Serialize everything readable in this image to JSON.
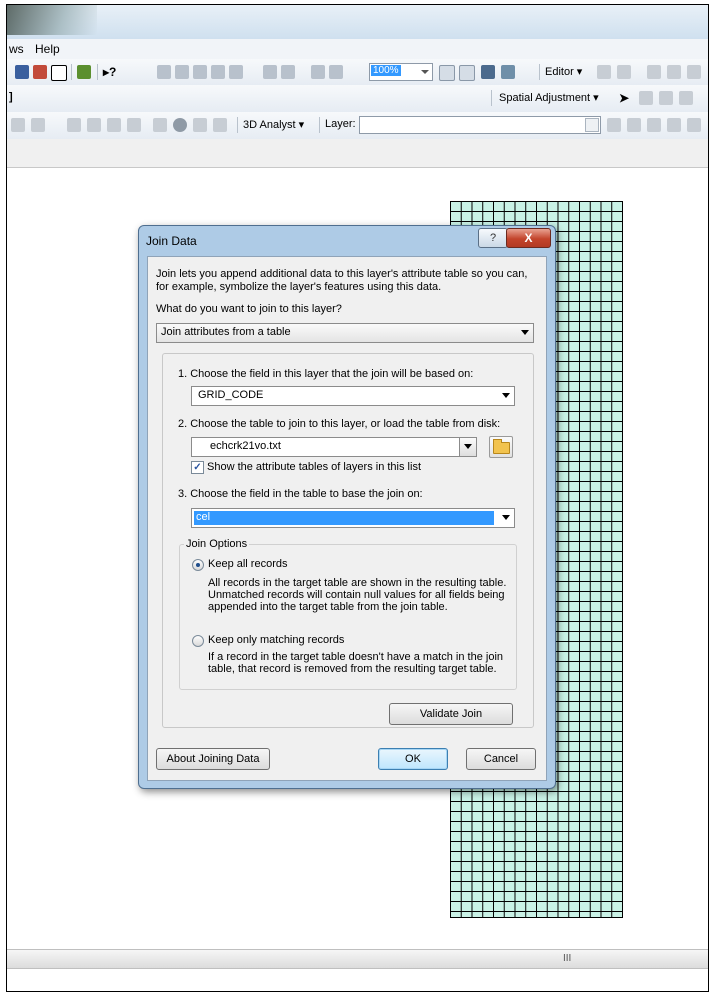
{
  "menubar": {
    "items": [
      "ws",
      "Help"
    ]
  },
  "toolbar": {
    "zoom_value": "100%",
    "editor_label": "Editor ▾",
    "spatial_adjustment_label": "Spatial Adjustment ▾",
    "analyst_label": "3D Analyst ▾",
    "layer_label": "Layer:"
  },
  "dialog": {
    "title": "Join Data",
    "help_glyph": "?",
    "close_glyph": "X",
    "intro_line1": "Join lets you append additional data to this layer's attribute table so you can,",
    "intro_line2": "for example, symbolize the layer's features using this data.",
    "question": "What do you want to join to this layer?",
    "join_type": "Join attributes from a table",
    "step1_label": "1.  Choose the field in this layer that the join will be based on:",
    "step1_value": "GRID_CODE",
    "step2_label": "2.  Choose the table to join to this layer, or load the table from disk:",
    "step2_value": "echcrk21vo.txt",
    "show_attr_tables_label": "Show the attribute tables of layers in this list",
    "show_attr_tables_checked": true,
    "step3_label": "3.  Choose the field in the table to base the join on:",
    "step3_value": "cel",
    "join_options_label": "Join Options",
    "keep_all_label": "Keep all records",
    "keep_all_desc1": "All records in the target table are shown in the resulting table.",
    "keep_all_desc2": "Unmatched records will contain null values for all fields being",
    "keep_all_desc3": "appended into the target table from the join table.",
    "keep_matching_label": "Keep only matching records",
    "keep_matching_desc1": "If a record in the target table doesn't have a match in the join",
    "keep_matching_desc2": "table, that record is removed from the resulting target table.",
    "selected_option": "Keep all records",
    "validate_label": "Validate Join",
    "about_label": "About Joining Data",
    "ok_label": "OK",
    "cancel_label": "Cancel"
  },
  "statusbar": {
    "grip": "III"
  },
  "colors": {
    "grid_fill": "#c9f2e6",
    "selection_blue": "#3399ff"
  }
}
